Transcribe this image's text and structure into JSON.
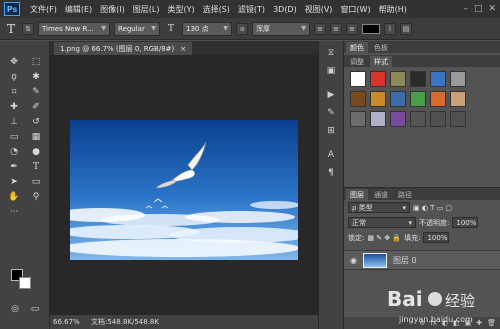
{
  "app": {
    "logo": "Ps"
  },
  "menu": [
    "文件(F)",
    "编辑(E)",
    "图像(I)",
    "图层(L)",
    "类型(Y)",
    "选择(S)",
    "滤镜(T)",
    "3D(D)",
    "视图(V)",
    "窗口(W)",
    "帮助(H)"
  ],
  "window_controls": [
    "–",
    "□",
    "✕"
  ],
  "options": {
    "font_family": "Times New R...",
    "font_style": "Regular",
    "font_size": "130 点",
    "antialias": "浑厚",
    "color": "#000000"
  },
  "document": {
    "tab_label": "1.png @ 66.7% (图层 0, RGB/8#)",
    "close_glyph": "×",
    "zoom": "66.67%",
    "doc_info": "文档:548.8K/548.8K"
  },
  "panels": {
    "top_tabs": [
      "颜色",
      "色板"
    ],
    "mid_tabs": [
      "调整",
      "样式"
    ],
    "style_colors": [
      "#ffffff",
      "#d9342b",
      "#8b8b5a",
      "#2a2a2a",
      "#3a75c4",
      "#9a9a9a",
      "#7a4b1e",
      "#c98a2a",
      "#3b6ea8",
      "#4a9e4a",
      "#d66a2f",
      "#c9a27a",
      "#6c6c6c",
      "#b0b0c8",
      "#7a4aa0",
      "#555555",
      "#505050",
      "#505050"
    ],
    "layers_tabs": [
      "图层",
      "通道",
      "路径"
    ],
    "filter_label": "ρ 类型",
    "blend_mode": "正常",
    "opacity_label": "不透明度:",
    "opacity_value": "100%",
    "lock_label": "锁定:",
    "fill_label": "填充:",
    "fill_value": "100%",
    "layer_name": "图层 0",
    "bottom_icons": [
      "⊖",
      "fx",
      "◐",
      "◧",
      "▣",
      "✚",
      "🗑"
    ]
  },
  "watermark": {
    "text_main": "Bai 经验",
    "text_sub": "jingyan.baidu.com"
  }
}
